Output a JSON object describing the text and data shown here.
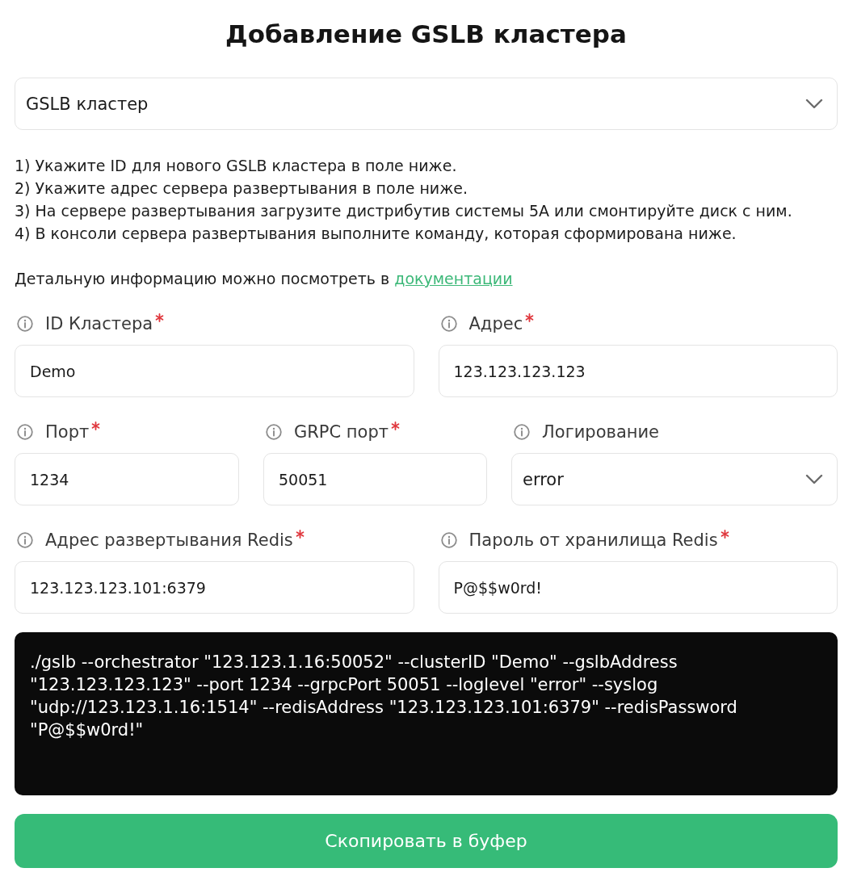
{
  "title": "Добавление GSLB кластера",
  "cluster_type": {
    "kind": "select",
    "value": "GSLB кластер"
  },
  "instructions": [
    "1) Укажите ID для нового GSLB кластера в поле ниже.",
    "2) Укажите адрес сервера развертывания в поле ниже.",
    "3) На сервере развертывания загрузите дистрибутив системы 5A или смонтируйте диск с ним.",
    "4) В консоли сервера развертывания выполните команду, которая сформирована ниже."
  ],
  "details": {
    "text": "Детальную информацию можно посмотреть в",
    "link": "документации"
  },
  "field_rows": [
    [
      {
        "kind": "input",
        "label": "ID Кластера",
        "required": true,
        "value": "Demo"
      },
      {
        "kind": "input",
        "label": "Адрес",
        "required": true,
        "value": "123.123.123.123"
      }
    ],
    [
      {
        "kind": "input",
        "label": "Порт",
        "required": true,
        "value": "1234"
      },
      {
        "kind": "input",
        "label": "GRPC порт",
        "required": true,
        "value": "50051"
      },
      {
        "kind": "select",
        "label": "Логирование",
        "required": false,
        "value": "error"
      }
    ],
    [
      {
        "kind": "input",
        "label": "Адрес развертывания Redis",
        "required": true,
        "value": "123.123.123.101:6379"
      },
      {
        "kind": "input",
        "label": "Пароль от хранилища Redis",
        "required": true,
        "value": "P@$$w0rd!"
      }
    ]
  ],
  "command": "./gslb --orchestrator \"123.123.1.16:50052\" --clusterID \"Demo\" --gslbAddress \"123.123.123.123\" --port 1234 --grpcPort 50051 --loglevel \"error\" --syslog \"udp://123.123.1.16:1514\" --redisAddress \"123.123.123.101:6379\" --redisPassword \"P@$$w0rd!\"",
  "copy_button": "Скопировать в буфер"
}
